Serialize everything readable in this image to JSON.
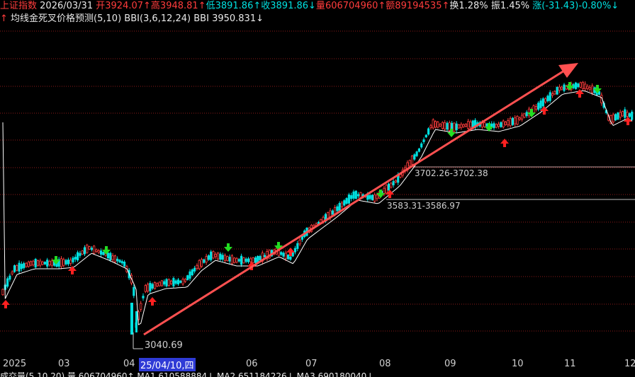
{
  "header": {
    "index_name": "上证指数",
    "date": "2026/03/31",
    "open_label": "开",
    "open_value": "3924.07↑",
    "high_label": "高",
    "high_value": "3948.81↑",
    "low_label": "低",
    "low_value": "3891.86↑",
    "close_label": "收",
    "close_value": "3891.86↓",
    "volume_label": "量",
    "volume_value": "606704960↑",
    "amount_label": "额",
    "amount_value": "89194535↑",
    "turnover": "换1.28%",
    "amplitude": "振1.45%",
    "change": "涨(-31.43)-0.80%↓"
  },
  "indicator": {
    "arrow": "↑",
    "name": "均线金死叉价格预测(5,10)",
    "bbi_params": "BBI(3,6,12,24)",
    "bbi_value": "BBI 3950.831↓"
  },
  "annotations": {
    "low_label": "3040.69",
    "level1": "3702.26-3702.38",
    "level2": "3583.31-3586.97"
  },
  "xaxis": {
    "labels": [
      "2025",
      "03",
      "04",
      "06",
      "07",
      "08",
      "09",
      "10",
      "11",
      "12"
    ],
    "cursor_date": "25/04/10,四"
  },
  "footer": {
    "text": "成交量(5,10,20)  量 606704960↑  MA1 610588884↓  MA2 651184226↓  MA3 690180040↓"
  },
  "colors": {
    "up": "#ff3c3c",
    "down": "#00e0e0",
    "ma_line": "#ffffff",
    "trend_arrow": "#ff5050",
    "buy_arrow": "#ff2020",
    "sell_arrow": "#22dd22",
    "grid": "#8b1a1a"
  },
  "chart_data": {
    "type": "candlestick",
    "title": "上证指数",
    "ylim": [
      3000,
      4050
    ],
    "x": [
      "2025",
      "03",
      "04",
      "06",
      "07",
      "08",
      "09",
      "10",
      "11",
      "12"
    ],
    "series": [
      {
        "name": "BBI",
        "values": [
          3280,
          3330,
          3350,
          3300,
          3150,
          3220,
          3290,
          3340,
          3360,
          3420,
          3510,
          3600,
          3700,
          3760,
          3790,
          3840,
          3900,
          3950,
          3890
        ]
      }
    ],
    "annotations": [
      "3040.69",
      "3702.26-3702.38",
      "3583.31-3586.97"
    ]
  }
}
